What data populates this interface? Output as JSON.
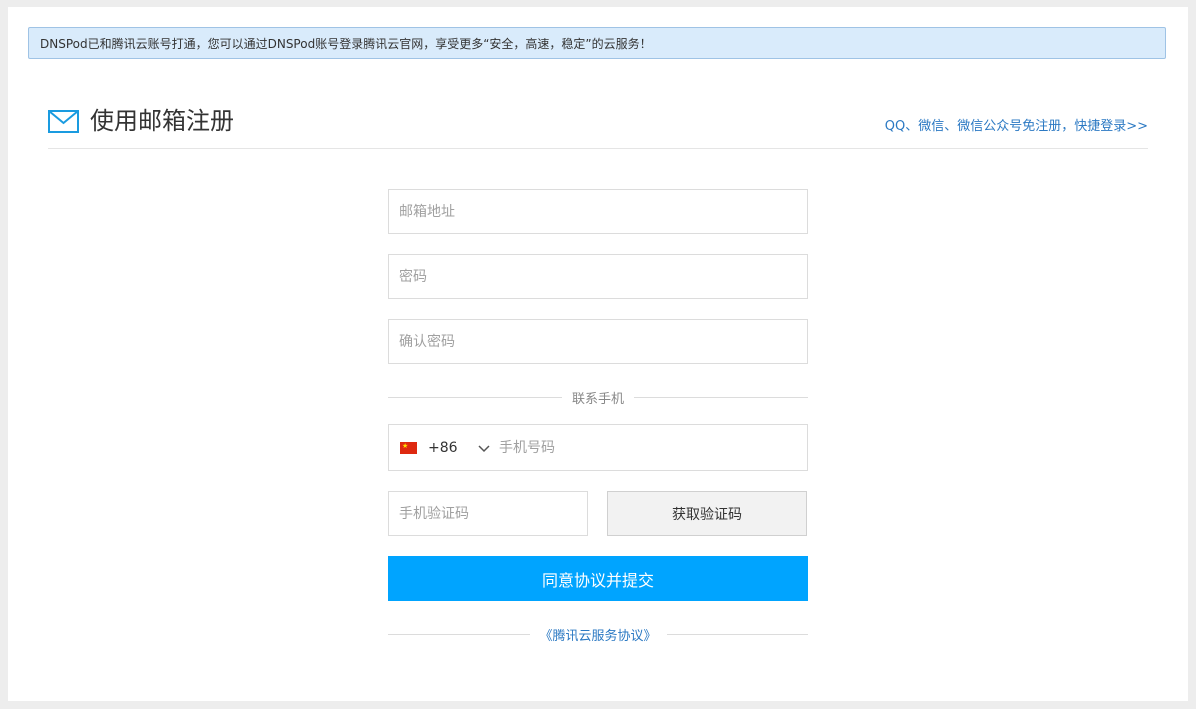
{
  "notice": {
    "text": "DNSPod已和腾讯云账号打通，您可以通过DNSPod账号登录腾讯云官网，享受更多“安全，高速，稳定”的云服务！"
  },
  "header": {
    "title": "使用邮箱注册",
    "quick_login": "QQ、微信、微信公众号免注册，快捷登录>>"
  },
  "form": {
    "email_placeholder": "邮箱地址",
    "password_placeholder": "密码",
    "confirm_password_placeholder": "确认密码",
    "phone_section_label": "联系手机",
    "country_code": "+86",
    "phone_placeholder": "手机号码",
    "sms_code_placeholder": "手机验证码",
    "get_code_label": "获取验证码",
    "submit_label": "同意协议并提交",
    "agreement_link": "《腾讯云服务协议》"
  },
  "colors": {
    "accent": "#00a4ff",
    "link": "#2b79c3",
    "notice_bg": "#d9ebfb"
  },
  "icons": {
    "mail": "mail-icon",
    "flag": "china-flag-icon",
    "chevron": "chevron-down-icon"
  }
}
